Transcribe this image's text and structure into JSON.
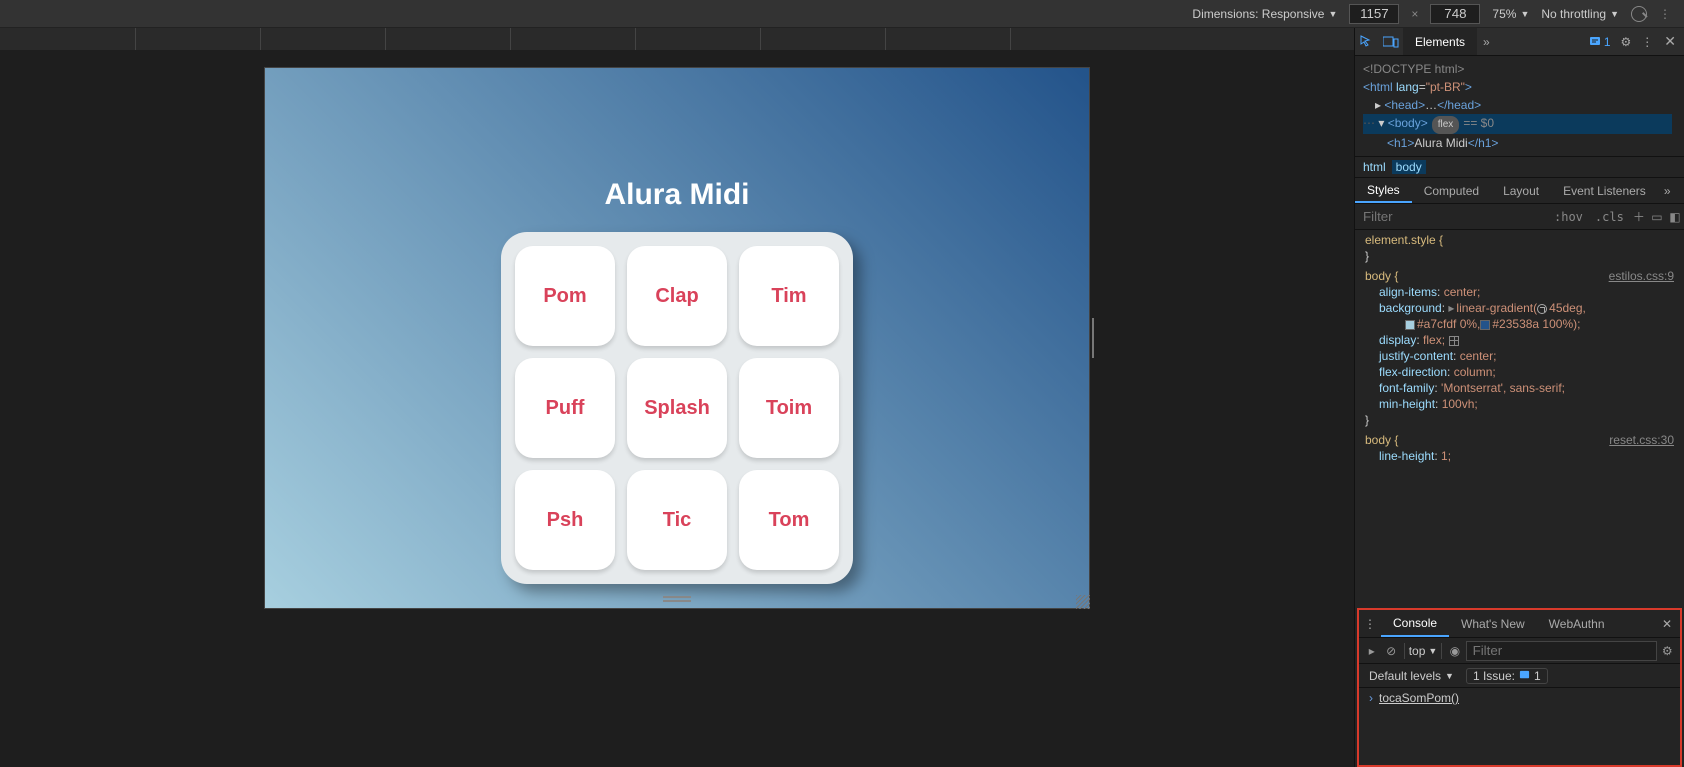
{
  "toolbar": {
    "dimensions_label": "Dimensions: Responsive",
    "width": "1157",
    "height": "748",
    "zoom": "75%",
    "throttle": "No throttling"
  },
  "app": {
    "title": "Alura Midi",
    "keys": [
      "Pom",
      "Clap",
      "Tim",
      "Puff",
      "Splash",
      "Toim",
      "Psh",
      "Tic",
      "Tom"
    ]
  },
  "devtools": {
    "tabs": {
      "elements": "Elements"
    },
    "issues_count": "1",
    "dom": {
      "doctype": "<!DOCTYPE html>",
      "html_open": "<html lang=\"pt-BR\">",
      "head": "<head>…</head>",
      "body_pill": "flex",
      "eq0": "== $0",
      "h1_text": "Alura Midi"
    },
    "breadcrumb": {
      "html": "html",
      "body": "body"
    },
    "styles_tabs": {
      "styles": "Styles",
      "computed": "Computed",
      "layout": "Layout",
      "listeners": "Event Listeners"
    },
    "filter_placeholder": "Filter",
    "hov": ":hov",
    "cls": ".cls",
    "rules": {
      "element_style": "element.style {",
      "brace_close": "}",
      "body_sel": "body {",
      "file1": "estilos.css:9",
      "file2": "reset.css:30",
      "p_align": "align-items",
      "v_align": "center;",
      "p_bg": "background",
      "v_bg_a": "linear-gradient(",
      "v_bg_deg": "45deg,",
      "v_bg_c1": "#a7cfdf 0%,",
      "v_bg_c2": "#23538a 100%);",
      "p_display": "display",
      "v_display": "flex;",
      "p_justify": "justify-content",
      "v_justify": "center;",
      "p_flexdir": "flex-direction",
      "v_flexdir": "column;",
      "p_ff": "font-family",
      "v_ff": "'Montserrat', sans-serif;",
      "p_minh": "min-height",
      "v_minh": "100vh;",
      "p_lh": "line-height",
      "v_lh": "1;"
    }
  },
  "drawer": {
    "tabs": {
      "console": "Console",
      "whatsnew": "What's New",
      "webauthn": "WebAuthn"
    },
    "context": "top",
    "filter_placeholder": "Filter",
    "levels": "Default levels",
    "issue_label": "1 Issue:",
    "issue_count": "1",
    "entry": "tocaSomPom()"
  }
}
